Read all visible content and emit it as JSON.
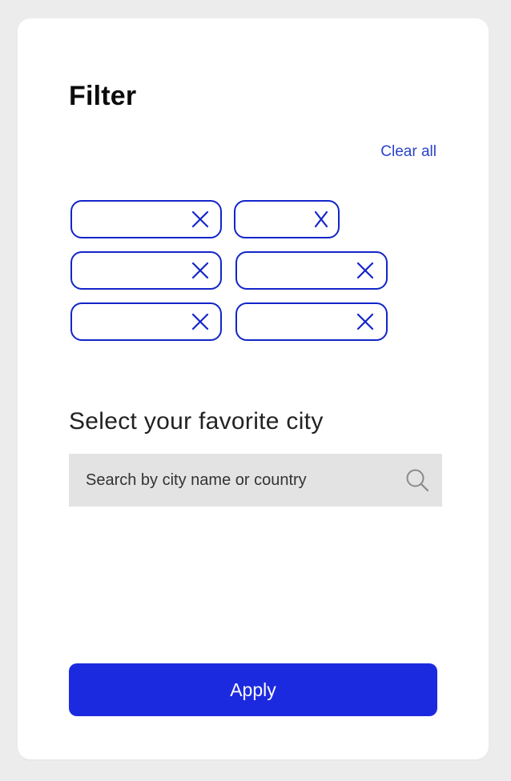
{
  "filter": {
    "title": "Filter",
    "clear_all_label": "Clear all",
    "chip_remove_icon": "close-icon",
    "chip_color": "#1325c9"
  },
  "city": {
    "heading": "Select your favorite city",
    "search_placeholder": "Search by city name or country",
    "search_value": "",
    "search_icon": "search-icon"
  },
  "actions": {
    "apply_label": "Apply",
    "apply_color": "#1c2adf"
  },
  "colors": {
    "accent": "#1c2adf",
    "link": "#2a43c9",
    "page_background": "#ececec",
    "input_background": "#e3e3e3"
  }
}
